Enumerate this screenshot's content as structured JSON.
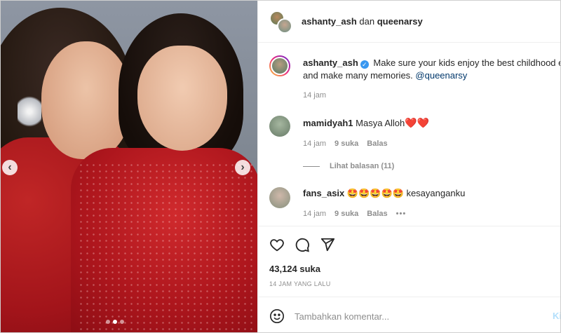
{
  "header": {
    "user1": "ashanty_ash",
    "joiner": "dan",
    "user2": "queenarsy"
  },
  "caption": {
    "username": "ashanty_ash",
    "line1": "Make sure your kids enjoy the best childhood ev",
    "line2": "and make many memories.",
    "mention": "@queenarsy",
    "time": "14 jam"
  },
  "comments": [
    {
      "username": "mamidyah1",
      "text": "Masya Alloh",
      "emoji": "❤️❤️",
      "time": "14 jam",
      "likes": "9 suka",
      "reply": "Balas",
      "view_replies": "Lihat balasan (11)"
    },
    {
      "username": "fans_asix",
      "emoji": "🤩🤩🤩🤩🤩",
      "text": "kesayanganku",
      "time": "14 jam",
      "likes": "9 suka",
      "reply": "Balas"
    }
  ],
  "actions": {
    "icons": [
      "heart-icon",
      "comment-icon",
      "share-icon"
    ]
  },
  "likes_count": "43,124 suka",
  "post_time": "14 JAM YANG LALU",
  "add_comment": {
    "placeholder": "Tambahkan komentar...",
    "post_label": "Ki"
  },
  "colors": {
    "link": "#00376b",
    "verified": "#3897f0",
    "muted": "#8e8e8e",
    "heart": "#ed4956"
  }
}
